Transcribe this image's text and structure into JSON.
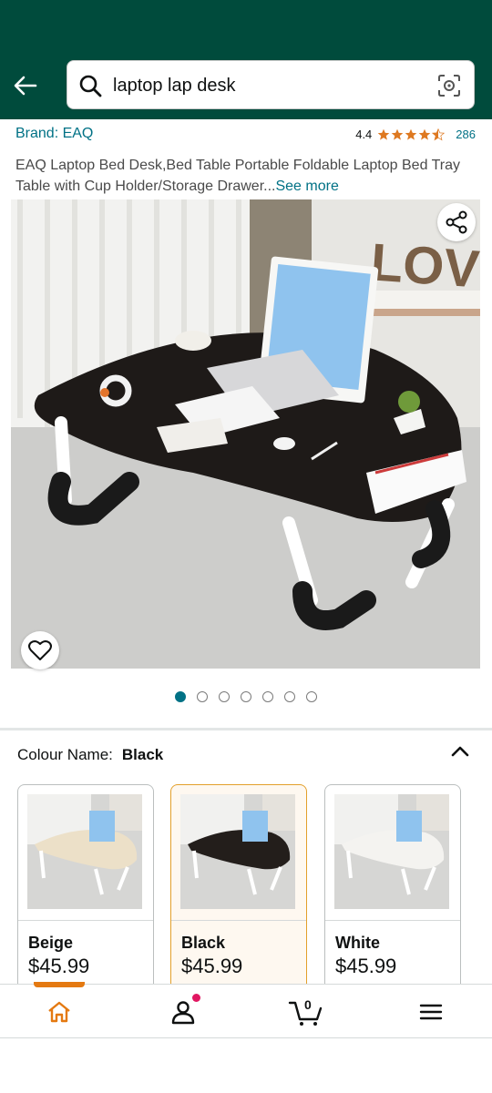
{
  "search": {
    "query": "laptop lap desk"
  },
  "product": {
    "brand": "Brand: EAQ",
    "rating": "4.4",
    "rating_count": "286",
    "title": "EAQ Laptop Bed Desk,Bed Table Portable Foldable Laptop Bed Tray Table with Cup Holder/Storage Drawer...",
    "see_more": "See more"
  },
  "carousel": {
    "count": 7,
    "active": 0
  },
  "colour": {
    "label": "Colour Name:",
    "selected": "Black",
    "options": [
      {
        "name": "Beige",
        "price": "$45.99"
      },
      {
        "name": "Black",
        "price": "$45.99"
      },
      {
        "name": "White",
        "price": "$45.99"
      }
    ]
  },
  "nav": {
    "cart_count": "0"
  },
  "colors": {
    "header": "#004b3c",
    "link": "#007185",
    "star": "#de7921",
    "accent": "#e47911"
  }
}
